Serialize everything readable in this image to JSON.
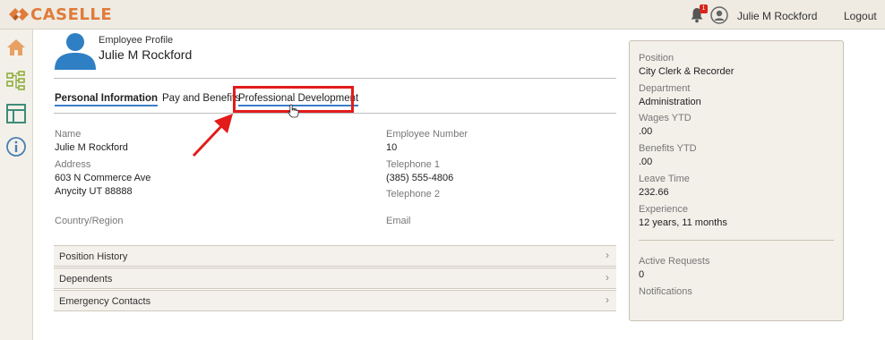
{
  "app": {
    "logo_text": "CASELLE"
  },
  "topbar": {
    "notification_count": "1",
    "user_name": "Julie M Rockford",
    "logout_label": "Logout"
  },
  "leftrail": {
    "icons": [
      "home-icon",
      "org-chart-icon",
      "layout-icon",
      "info-icon"
    ]
  },
  "profile": {
    "subtitle": "Employee Profile",
    "name": "Julie M Rockford"
  },
  "tabs": [
    {
      "label": "Personal Information"
    },
    {
      "label": "Pay and Benefits"
    },
    {
      "label": "Professional Development"
    }
  ],
  "details": {
    "name_label": "Name",
    "name_value": "Julie M Rockford",
    "address_label": "Address",
    "address_line1": "603 N Commerce Ave",
    "address_line2": "Anycity UT 88888",
    "country_label": "Country/Region",
    "emp_number_label": "Employee Number",
    "emp_number_value": "10",
    "telephone1_label": "Telephone 1",
    "telephone1_value": "(385) 555-4806",
    "telephone2_label": "Telephone 2",
    "email_label": "Email"
  },
  "accordions": [
    {
      "label": "Position History"
    },
    {
      "label": "Dependents"
    },
    {
      "label": "Emergency Contacts"
    }
  ],
  "summary": {
    "position_label": "Position",
    "position_value": "City Clerk & Recorder",
    "department_label": "Department",
    "department_value": "Administration",
    "wages_label": "Wages YTD",
    "wages_value": ".00",
    "benefits_label": "Benefits YTD",
    "benefits_value": ".00",
    "leave_label": "Leave Time",
    "leave_value": "232.66",
    "experience_label": "Experience",
    "experience_value": "12 years, 11 months",
    "active_requests_label": "Active Requests",
    "active_requests_value": "0",
    "notifications_label": "Notifications"
  },
  "colors": {
    "brand": "#e07b39",
    "highlight": "#e31b1b",
    "tab_underline": "#3a7dc9",
    "avatar_blue": "#2f7fc4"
  }
}
